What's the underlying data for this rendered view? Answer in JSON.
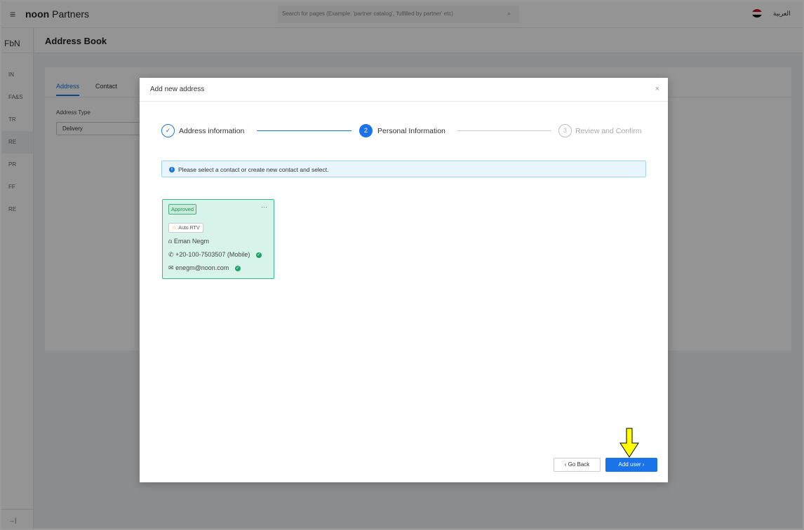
{
  "topbar": {
    "brand_bold": "noon",
    "brand_rest": " Partners",
    "search_placeholder": "Search for pages (Example: 'partner catalog', 'fulfilled by partner' etc)",
    "language": "العربية"
  },
  "sidebar": {
    "header": "FbN",
    "items": [
      {
        "label": "IN"
      },
      {
        "label": "FA&S"
      },
      {
        "label": "TR"
      },
      {
        "label": "RE"
      },
      {
        "label": "PR"
      },
      {
        "label": "FF"
      },
      {
        "label": "RE"
      }
    ],
    "footer": "→|"
  },
  "page": {
    "title": "Address Book",
    "tabs": [
      {
        "label": "Address"
      },
      {
        "label": "Contact"
      }
    ],
    "address_type_label": "Address Type",
    "address_type_value": "Delivery"
  },
  "modal": {
    "title": "Add new address",
    "close": "×",
    "steps": [
      {
        "number": "✓",
        "label": "Address information",
        "state": "done"
      },
      {
        "number": "2",
        "label": "Personal Information",
        "state": "active"
      },
      {
        "number": "3",
        "label": "Review and Confirm",
        "state": "pending"
      }
    ],
    "info_message": "Please select a contact or create new contact and select.",
    "contact": {
      "status": "Approved",
      "menu": "···",
      "tag": "Auto RTV",
      "name": "Eman Negm",
      "phone": "+20-100-7503507 (Mobile)",
      "email": "enegm@noon.com"
    },
    "back_label": "Go Back",
    "add_label": "Add user"
  },
  "colors": {
    "primary": "#1a73e8",
    "approved_bg": "#d8f3ea",
    "approved_border": "#3bb88b",
    "arrow": "#ffff00"
  }
}
